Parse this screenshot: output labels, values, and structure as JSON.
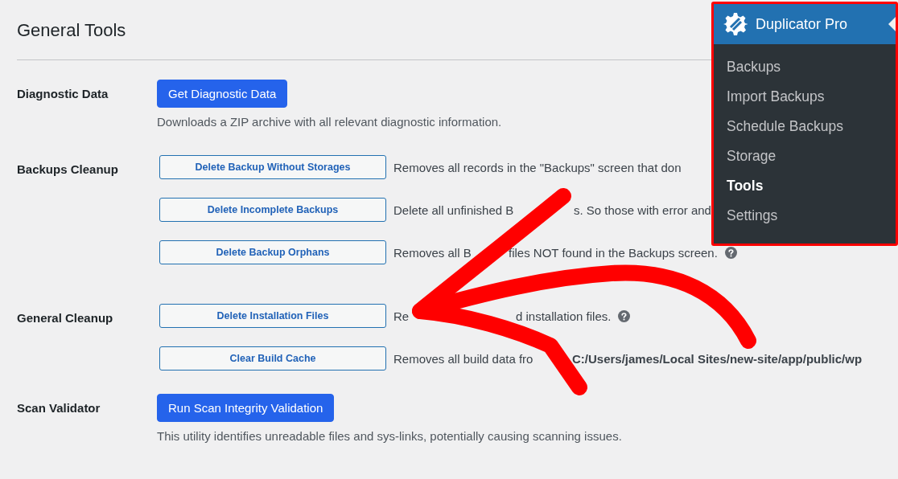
{
  "page_title": "General Tools",
  "sections": [
    {
      "label": "Diagnostic Data",
      "rows": [
        {
          "button": {
            "label": "Get Diagnostic Data",
            "kind": "primary"
          },
          "note": "Downloads a ZIP archive with all relevant diagnostic information."
        }
      ]
    },
    {
      "label": "Backups Cleanup",
      "rows": [
        {
          "button": {
            "label": "Delete Backup Without Storages",
            "kind": "secondary"
          },
          "description": [
            "Removes all records in the \"Backups\" screen that don"
          ],
          "help": false
        },
        {
          "button": {
            "label": "Delete Incomplete Backups",
            "kind": "secondary"
          },
          "description": [
            "Delete all unfinished B",
            "s. So those with error and"
          ],
          "help": false
        },
        {
          "button": {
            "label": "Delete Backup Orphans",
            "kind": "secondary"
          },
          "description": [
            "Removes all B",
            "files NOT found in the Backups screen."
          ],
          "help": true
        }
      ]
    },
    {
      "label": "General Cleanup",
      "rows": [
        {
          "button": {
            "label": "Delete Installation Files",
            "kind": "secondary"
          },
          "description": [
            "Re",
            "d installation files."
          ],
          "help": true
        },
        {
          "button": {
            "label": "Clear Build Cache",
            "kind": "secondary"
          },
          "description": [
            "Removes all build data fro",
            "**C:/Users/james/Local Sites/new-site/app/public/wp**"
          ],
          "help": false
        }
      ]
    },
    {
      "label": "Scan Validator",
      "rows": [
        {
          "button": {
            "label": "Run Scan Integrity Validation",
            "kind": "primary"
          },
          "note": "This utility identifies unreadable files and sys-links, potentially causing scanning issues."
        }
      ]
    }
  ],
  "menu": {
    "title": "Duplicator Pro",
    "items": [
      {
        "label": "Backups",
        "selected": false
      },
      {
        "label": "Import Backups",
        "selected": false
      },
      {
        "label": "Schedule Backups",
        "selected": false
      },
      {
        "label": "Storage",
        "selected": false
      },
      {
        "label": "Tools",
        "selected": true
      },
      {
        "label": "Settings",
        "selected": false
      }
    ]
  }
}
